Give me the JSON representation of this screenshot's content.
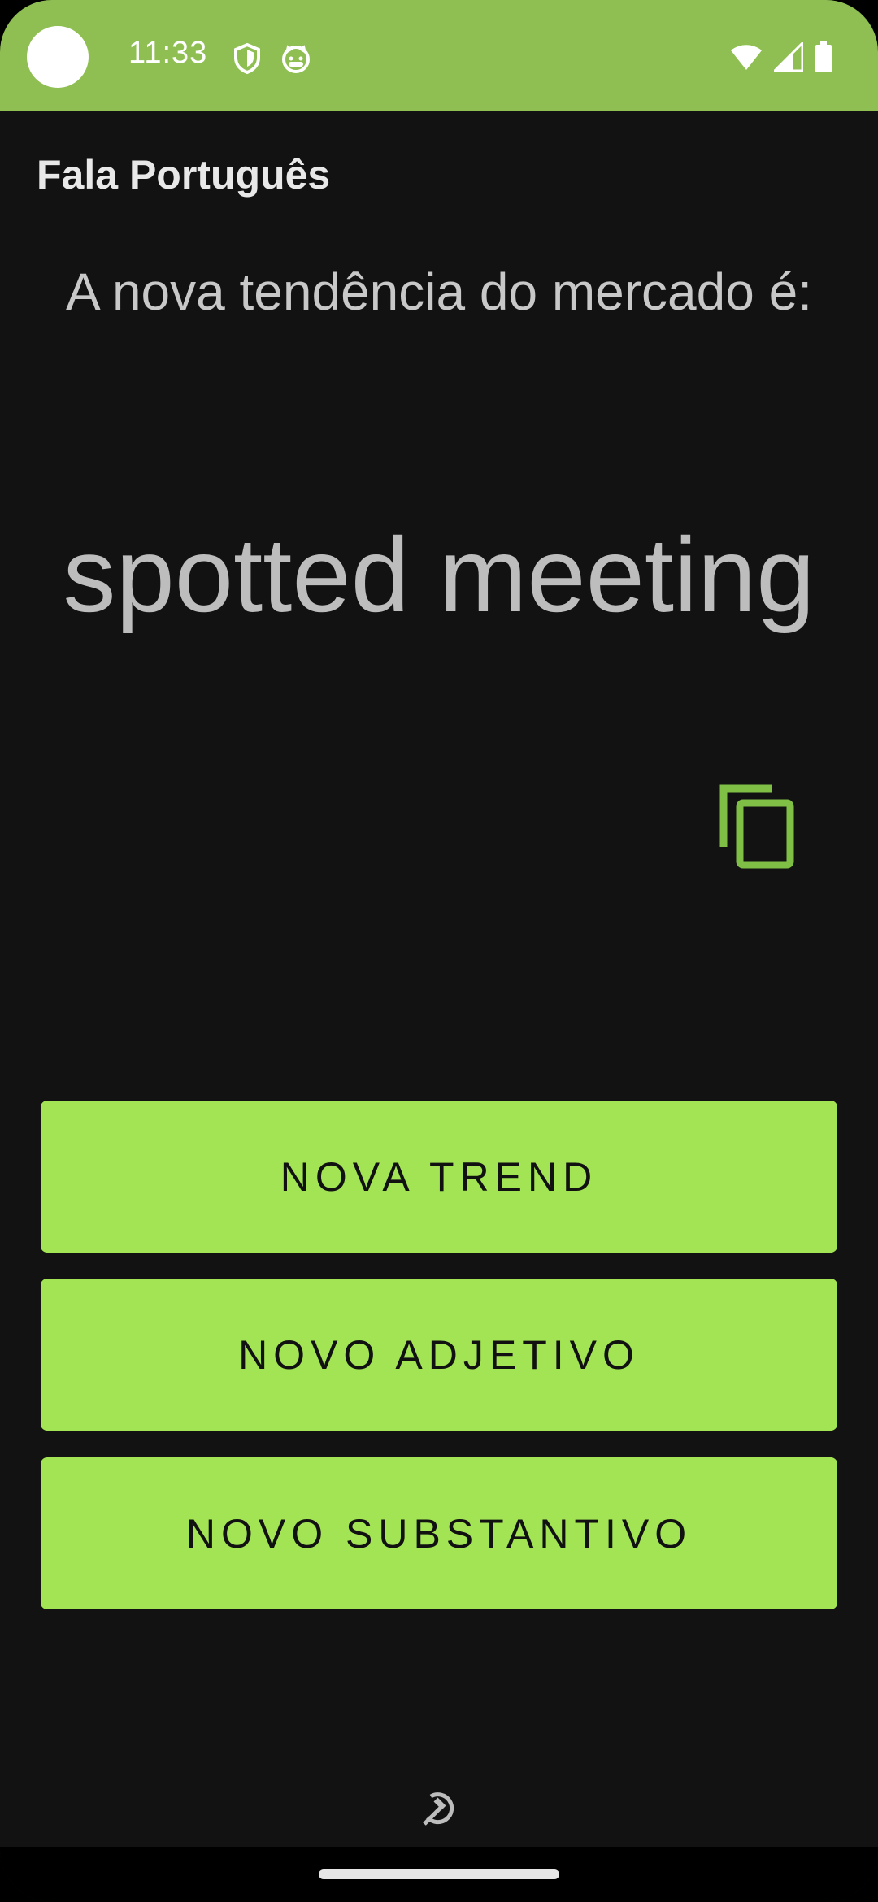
{
  "status_bar": {
    "time": "11:33",
    "icons_left": [
      "shield-icon",
      "cat-icon"
    ],
    "icons_right": [
      "wifi-icon",
      "signal-icon",
      "battery-icon"
    ],
    "background": "#8fbf52"
  },
  "app": {
    "title": "Fala Português"
  },
  "main": {
    "prompt": "A nova tendência do mercado é:",
    "phrase": "spotted meeting",
    "copy_icon": "copy-icon"
  },
  "buttons": {
    "new_trend": "NOVA TREND",
    "new_adjective": "NOVO ADJETIVO",
    "new_noun": "NOVO SUBSTANTIVO"
  },
  "colors": {
    "accent": "#a3e454",
    "copy_icon": "#7fbf45",
    "background": "#121212"
  },
  "footer": {
    "emblem_icon": "hammer-sickle-icon"
  }
}
